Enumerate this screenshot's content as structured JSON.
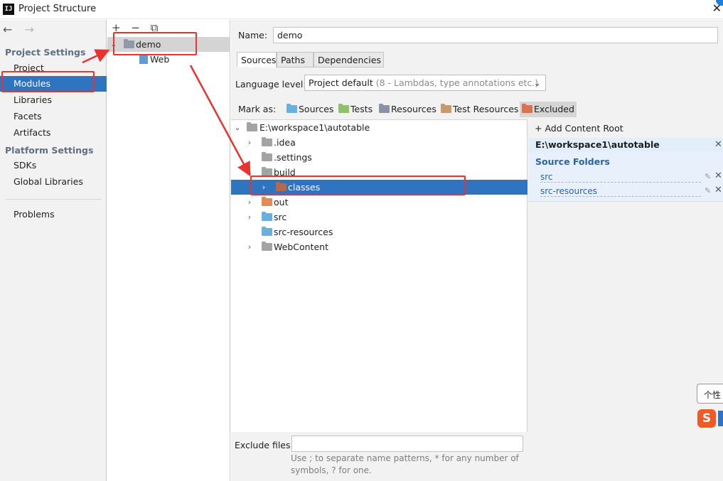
{
  "window": {
    "app_icon": "IJ",
    "title": "Project Structure",
    "close_glyph": "✕"
  },
  "nav": {
    "back_glyph": "←",
    "forward_glyph": "→"
  },
  "sidebar": {
    "project_settings_header": "Project Settings",
    "items": [
      {
        "label": "Project"
      },
      {
        "label": "Modules",
        "selected": true
      },
      {
        "label": "Libraries"
      },
      {
        "label": "Facets"
      },
      {
        "label": "Artifacts"
      }
    ],
    "platform_settings_header": "Platform Settings",
    "platform_items": [
      {
        "label": "SDKs"
      },
      {
        "label": "Global Libraries"
      }
    ],
    "problems": "Problems"
  },
  "modules": {
    "toolbar": {
      "add": "+",
      "remove": "−",
      "copy": "⧉"
    },
    "items": [
      {
        "label": "demo",
        "selected": true
      },
      {
        "label": "Web"
      }
    ]
  },
  "main": {
    "name_label": "Name:",
    "name_value": "demo",
    "tabs": [
      {
        "label": "Sources",
        "active": true
      },
      {
        "label": "Paths"
      },
      {
        "label": "Dependencies"
      }
    ],
    "language_level_label": "Language level:",
    "language_level_value": "Project default",
    "language_level_hint": "(8 - Lambdas, type annotations etc.)",
    "mark_as_label": "Mark as:",
    "mark_as": [
      {
        "label": "Sources",
        "icon": "sources-folder-icon",
        "color": "#6ab0de"
      },
      {
        "label": "Tests",
        "icon": "tests-folder-icon",
        "color": "#8fc16a"
      },
      {
        "label": "Resources",
        "icon": "resources-folder-icon",
        "color": "#8a93a3"
      },
      {
        "label": "Test Resources",
        "icon": "test-resources-folder-icon",
        "color": "#c89a6a"
      },
      {
        "label": "Excluded",
        "icon": "excluded-folder-icon",
        "color": "#d7744f",
        "selected": true
      }
    ],
    "tree": [
      {
        "label": "E:\\workspace1\\autotable",
        "expanded": true
      },
      {
        "label": ".idea",
        "collapsed": true
      },
      {
        "label": ".settings"
      },
      {
        "label": "build",
        "expanded": true
      },
      {
        "label": "classes",
        "collapsed": true,
        "selected": true
      },
      {
        "label": "out",
        "collapsed": true
      },
      {
        "label": "src",
        "collapsed": true
      },
      {
        "label": "src-resources"
      },
      {
        "label": "WebContent",
        "collapsed": true
      }
    ],
    "exclude_files_label": "Exclude files:",
    "exclude_files_value": "",
    "exclude_hint_line1": "Use ; to separate name patterns, * for any number of",
    "exclude_hint_line2": "symbols, ? for one."
  },
  "content_roots": {
    "add_label": "Add Content Root",
    "root_path": "E:\\workspace1\\autotable",
    "source_folders_title": "Source Folders",
    "source_folders": [
      "src",
      "src-resources"
    ]
  },
  "overlay": {
    "tooltip_text": "个性",
    "ime_logo_text": "S"
  },
  "colors": {
    "selection": "#2f74c0",
    "highlight": "#e8332f",
    "source_link": "#2a63a8"
  }
}
